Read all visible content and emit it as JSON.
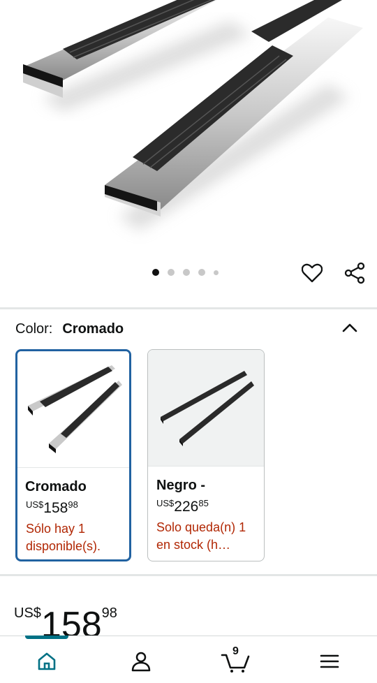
{
  "gallery": {
    "image_alt": "Estribos laterales de acero inoxidable cromado con peldaños negros",
    "dot_count": 5,
    "active_dot": 0
  },
  "variation": {
    "label": "Color:",
    "selected_value": "Cromado",
    "options": [
      {
        "name": "Cromado",
        "currency": "US$",
        "price_whole": "158",
        "price_cents": "98",
        "availability": "Sólo hay 1 disponible(s).",
        "selected": true
      },
      {
        "name": "Negro -",
        "currency": "US$",
        "price_whole": "226",
        "price_cents": "85",
        "availability": "Solo queda(n) 1 en stock (h…",
        "selected": false
      }
    ]
  },
  "price": {
    "currency": "US$",
    "whole": "158",
    "cents": "98"
  },
  "bottom_nav": {
    "items": [
      "home-icon",
      "account-icon",
      "cart-icon",
      "menu-icon"
    ],
    "cart_count": "9",
    "accent_color": "#007185"
  },
  "colors": {
    "selected_border": "#2162a1",
    "availability_red": "#b12704"
  }
}
